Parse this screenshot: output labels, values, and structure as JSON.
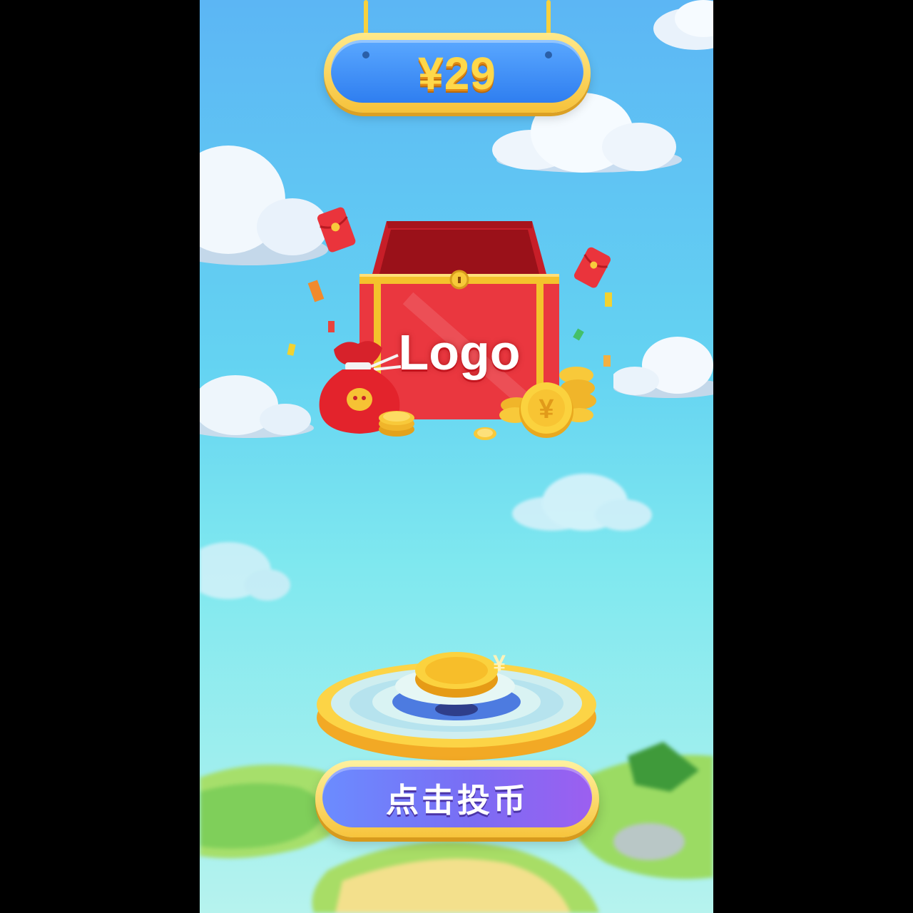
{
  "price": {
    "label": "¥29"
  },
  "chest": {
    "logo_text": "Logo"
  },
  "coin_slot": {
    "coin_symbol": "¥"
  },
  "action": {
    "insert_coin_label": "点击投币"
  },
  "colors": {
    "sky_top": "#5cb6f4",
    "chest_red": "#e8343c",
    "gold": "#f7c43c",
    "button_purple": "#7a6df4",
    "price_blue": "#2f7ef0"
  }
}
